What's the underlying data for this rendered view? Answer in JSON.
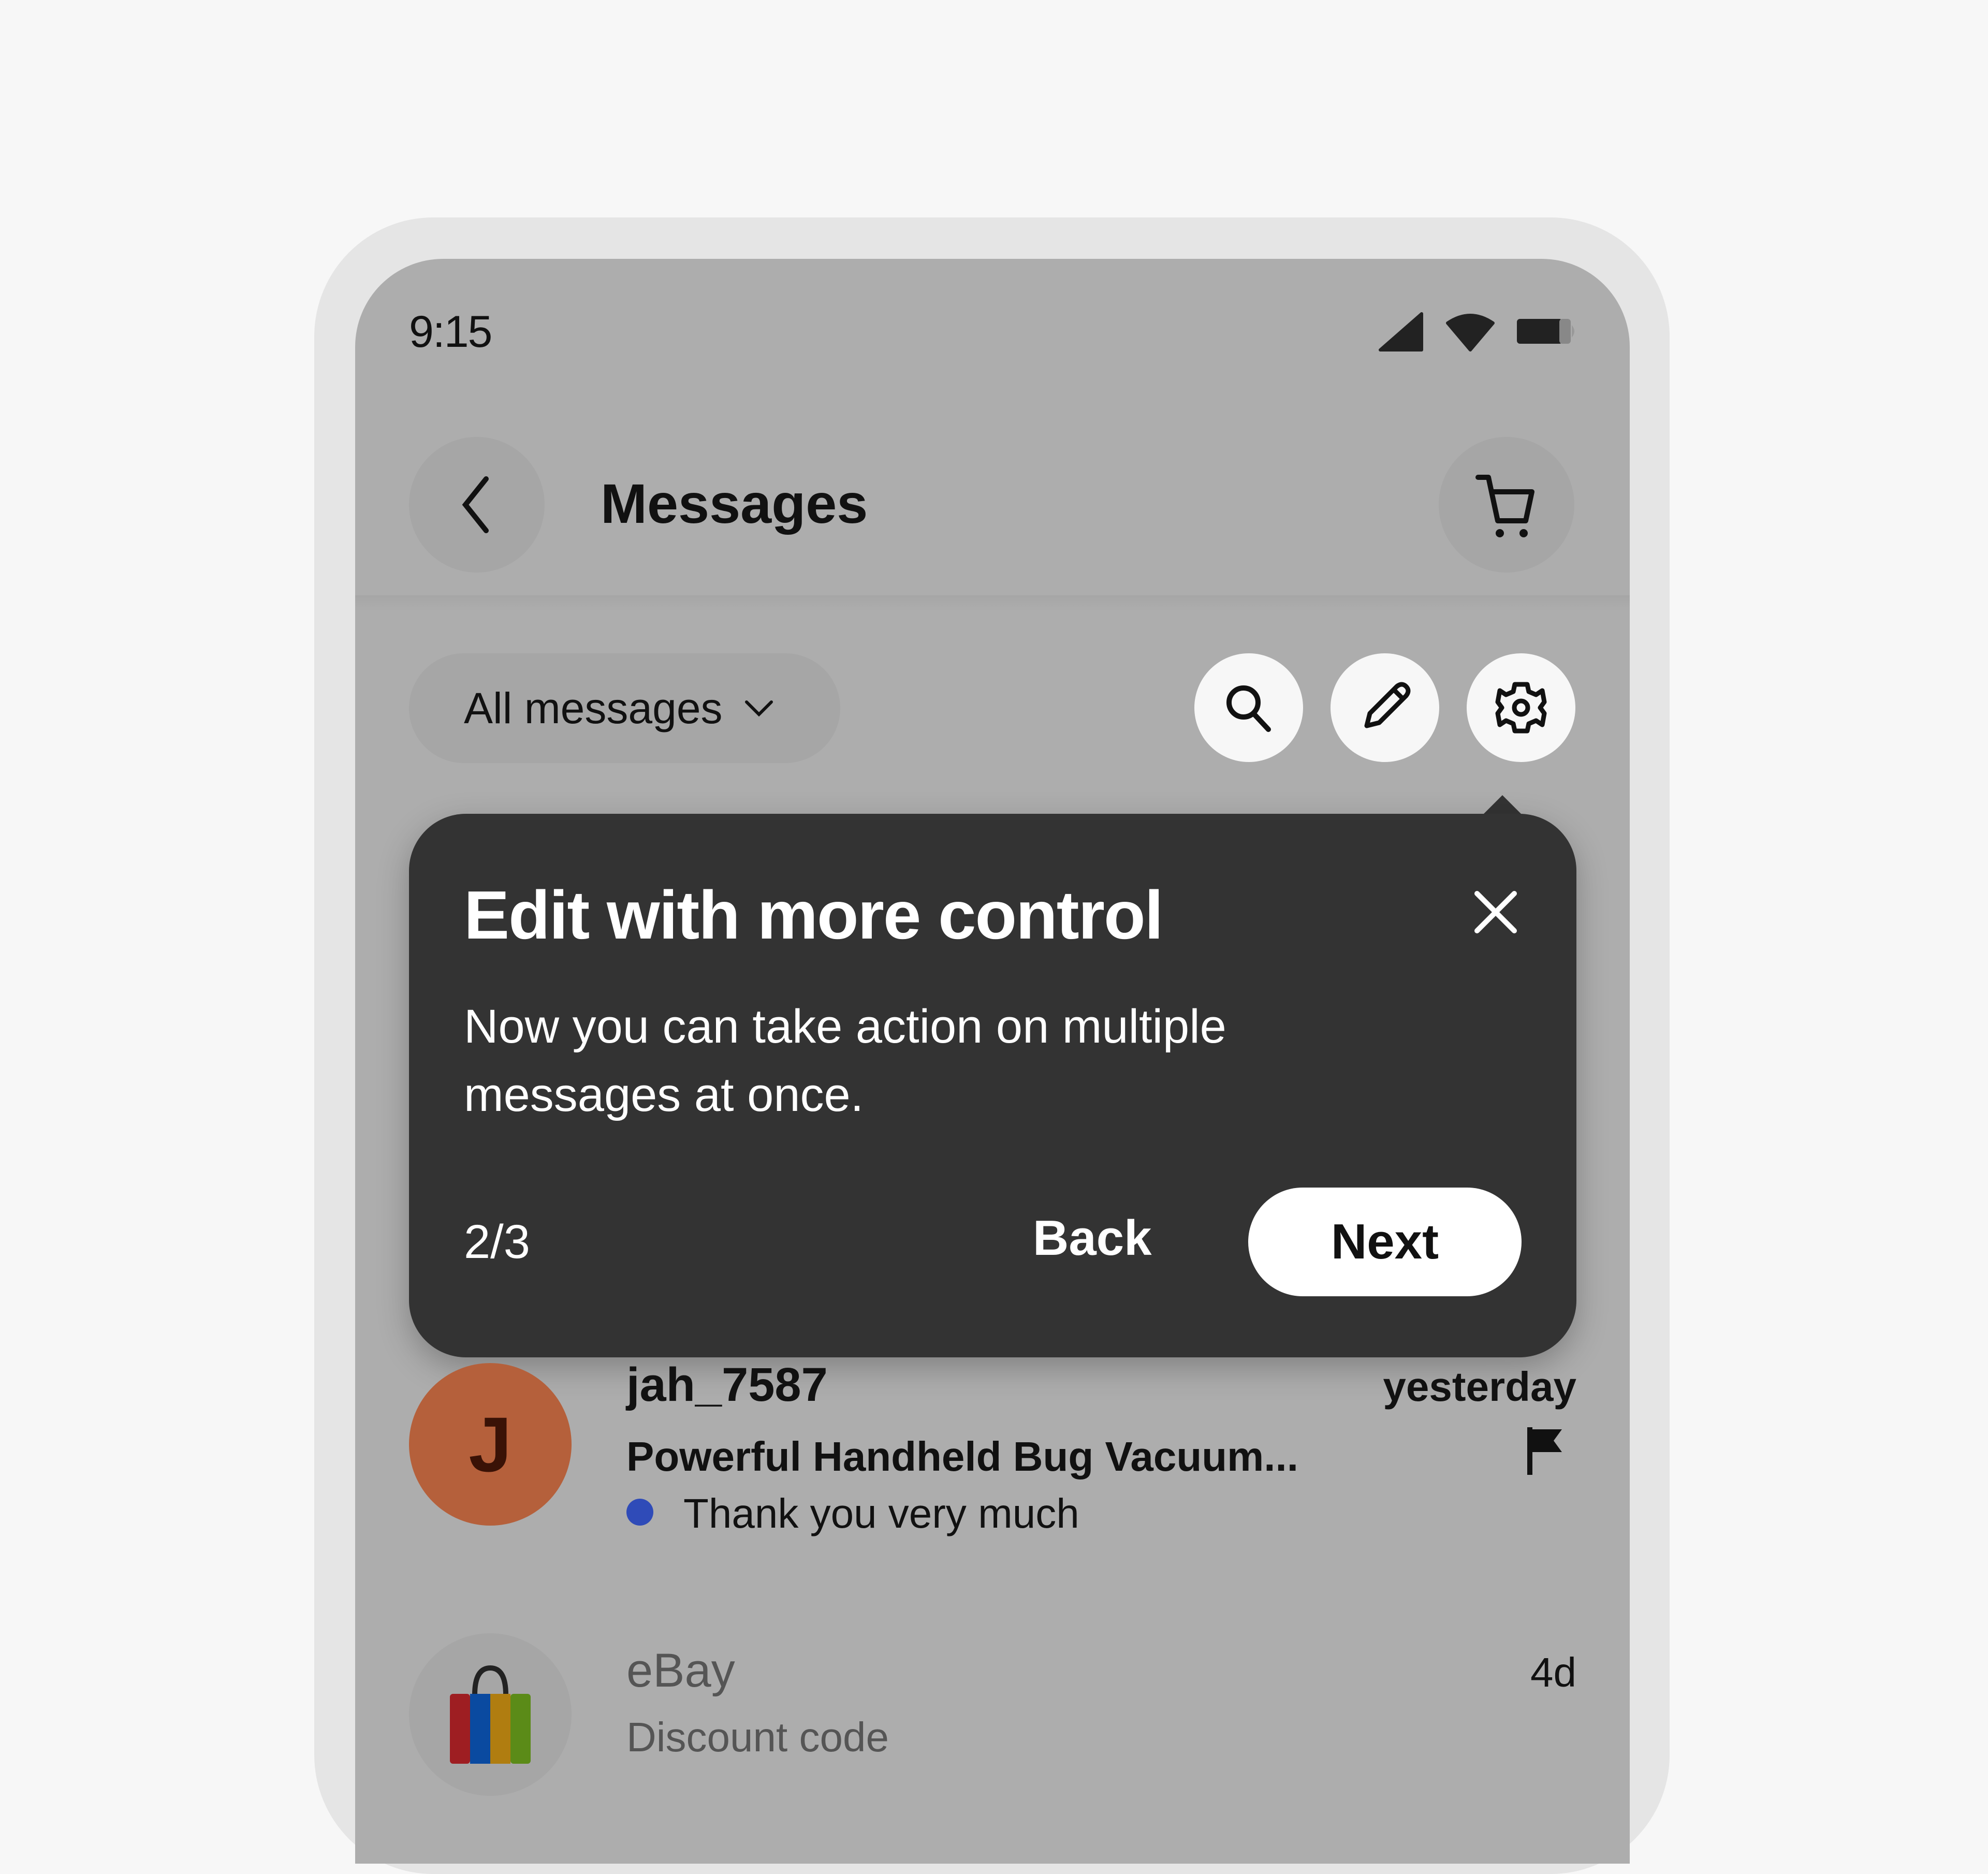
{
  "status_bar": {
    "time": "9:15"
  },
  "header": {
    "title": "Messages",
    "back_icon": "chevron-left-icon",
    "cart_icon": "cart-icon"
  },
  "filter": {
    "selected": "All messages"
  },
  "actions": [
    {
      "name": "search",
      "icon": "search-icon"
    },
    {
      "name": "edit",
      "icon": "pencil-icon"
    },
    {
      "name": "settings",
      "icon": "gear-icon"
    }
  ],
  "tooltip": {
    "title": "Edit with more control",
    "body": "Now you can take action on multiple messages at once.",
    "step": "2/3",
    "back_label": "Back",
    "next_label": "Next"
  },
  "messages": [
    {
      "avatar_initial": "J",
      "sender": "jah_7587",
      "time": "yesterday",
      "subject": "Powerful Handheld Bug Vacuum...",
      "preview": "Thank you very much",
      "unread": true,
      "flagged": true
    },
    {
      "sender": "eBay",
      "time": "4d",
      "preview": "Discount code",
      "unread": false,
      "flagged": false
    }
  ],
  "colors": {
    "avatar_j": "#b5603b",
    "unread_dot": "#2f4bb8",
    "tooltip_bg": "#333333",
    "overlay_bg": "#adadad"
  }
}
